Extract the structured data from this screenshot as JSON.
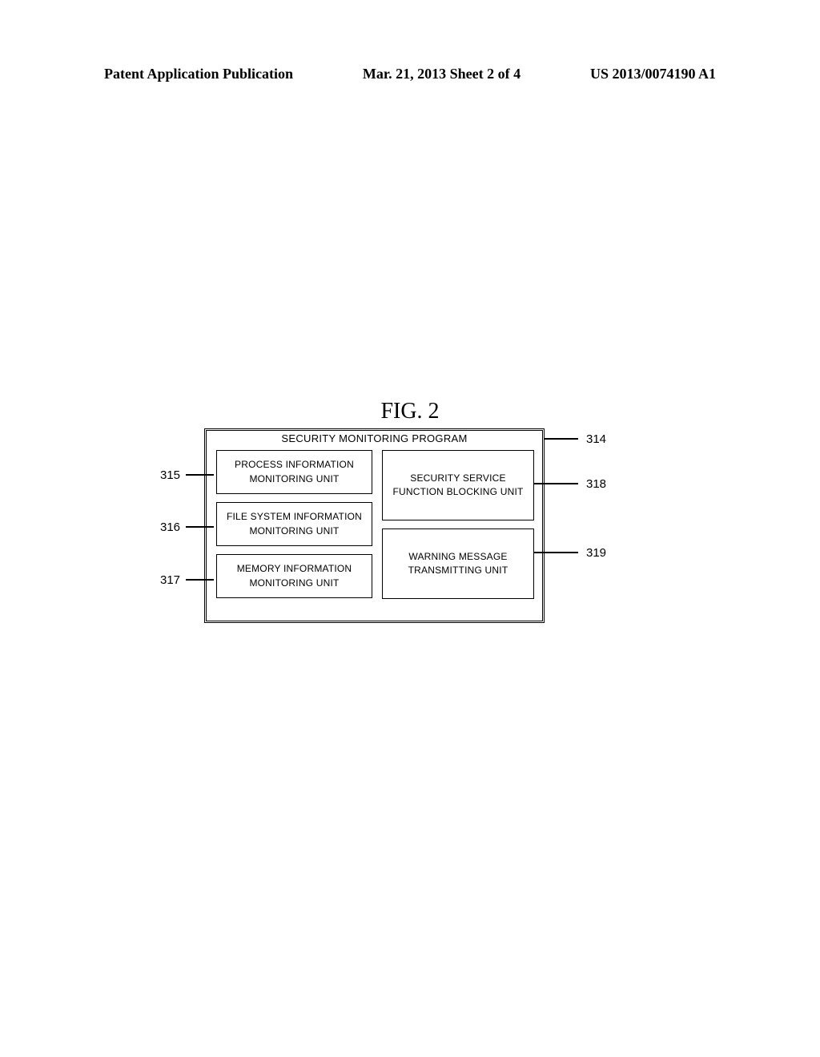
{
  "header": {
    "left": "Patent Application Publication",
    "center": "Mar. 21, 2013  Sheet 2 of 4",
    "right": "US 2013/0074190 A1"
  },
  "figure": {
    "title": "FIG. 2",
    "outer_title": "SECURITY MONITORING PROGRAM",
    "box_315_line1": "PROCESS INFORMATION",
    "box_315_line2": "MONITORING UNIT",
    "box_316_line1": "FILE SYSTEM INFORMATION",
    "box_316_line2": "MONITORING UNIT",
    "box_317_line1": "MEMORY INFORMATION",
    "box_317_line2": "MONITORING UNIT",
    "box_318_line1": "SECURITY SERVICE",
    "box_318_line2": "FUNCTION BLOCKING UNIT",
    "box_319_line1": "WARNING MESSAGE",
    "box_319_line2": "TRANSMITTING UNIT"
  },
  "callouts": {
    "c314": "314",
    "c315": "315",
    "c316": "316",
    "c317": "317",
    "c318": "318",
    "c319": "319"
  }
}
